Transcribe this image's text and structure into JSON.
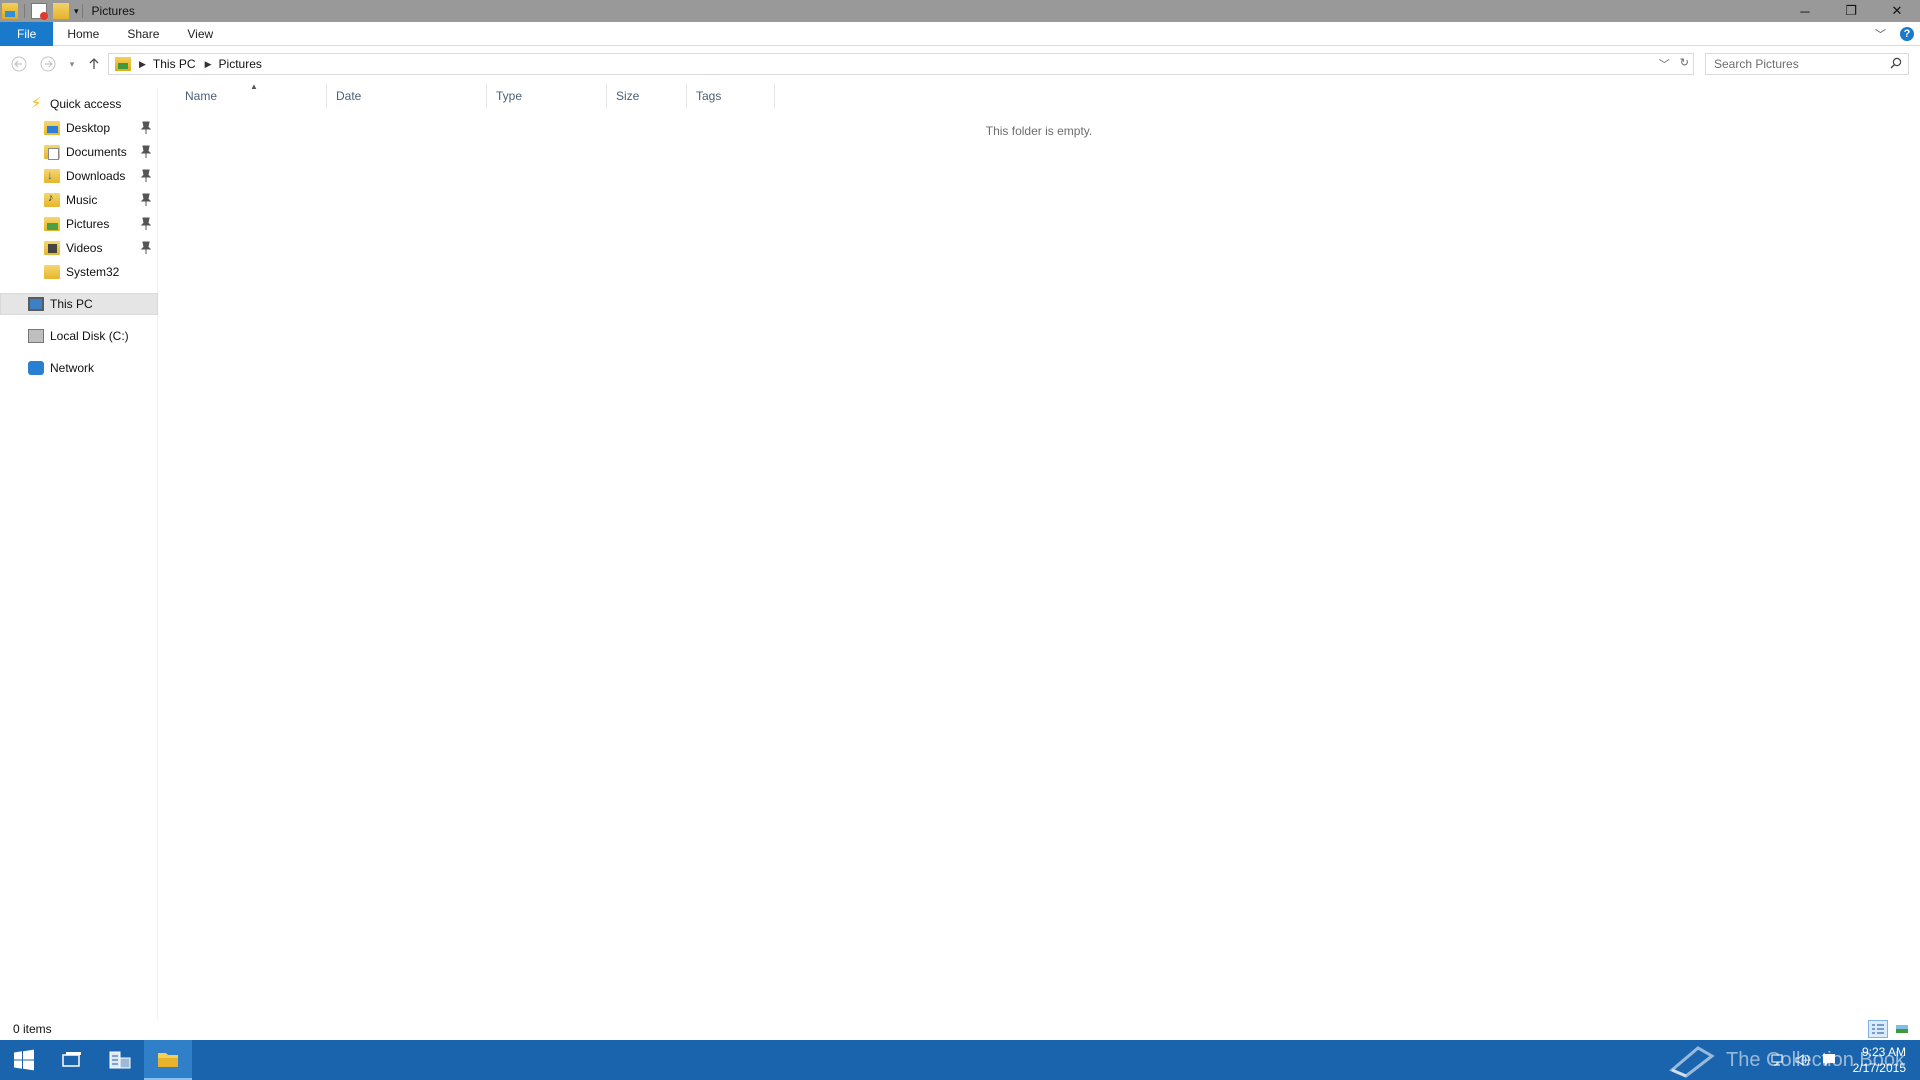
{
  "window": {
    "title": "Pictures",
    "buttons": {
      "minimize": "─",
      "restore": "❐",
      "close": "✕"
    }
  },
  "ribbon": {
    "tabs": [
      "File",
      "Home",
      "Share",
      "View"
    ],
    "help_label": "?"
  },
  "address": {
    "breadcrumbs": [
      "This PC",
      "Pictures"
    ]
  },
  "search": {
    "placeholder": "Search Pictures"
  },
  "navpane": {
    "quick_access": "Quick access",
    "pinned": [
      {
        "label": "Desktop",
        "icon": "desktop-folder-icon"
      },
      {
        "label": "Documents",
        "icon": "documents-folder-icon"
      },
      {
        "label": "Downloads",
        "icon": "downloads-folder-icon"
      },
      {
        "label": "Music",
        "icon": "music-folder-icon"
      },
      {
        "label": "Pictures",
        "icon": "pictures-folder-icon"
      },
      {
        "label": "Videos",
        "icon": "videos-folder-icon"
      },
      {
        "label": "System32",
        "icon": "folder-icon"
      }
    ],
    "this_pc": "This PC",
    "local_disk": "Local Disk (C:)",
    "network": "Network"
  },
  "columns": [
    "Name",
    "Date",
    "Type",
    "Size",
    "Tags"
  ],
  "content": {
    "empty_message": "This folder is empty."
  },
  "status": {
    "item_count": "0 items"
  },
  "taskbar": {
    "watermark": "The Collection Book",
    "time": "9:23 AM",
    "date": "2/17/2015"
  },
  "colors": {
    "accent": "#1979ca",
    "titlebar": "#999999",
    "taskbar": "#1a64ad",
    "column_header_text": "#4c607a"
  }
}
